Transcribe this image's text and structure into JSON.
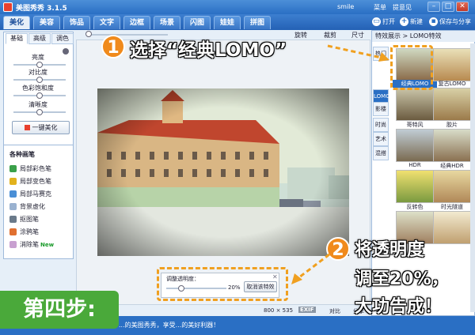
{
  "titlebar": {
    "app_name": "美图秀秀 3.1.5",
    "user": "smile",
    "links": [
      "菜单",
      "提意见"
    ],
    "buttons": [
      "–",
      "□",
      "✕"
    ]
  },
  "menu": {
    "tabs": [
      "美化",
      "美容",
      "饰品",
      "文字",
      "边框",
      "场景",
      "闪图",
      "娃娃",
      "拼图"
    ],
    "actions": [
      "打开",
      "新建",
      "保存与分享"
    ]
  },
  "left_panel": {
    "subtabs": [
      "基础",
      "高级",
      "调色"
    ],
    "sliders": [
      {
        "label": "亮度",
        "value": 0.5
      },
      {
        "label": "对比度",
        "value": 0.5
      },
      {
        "label": "色彩饱和度",
        "value": 0.5
      },
      {
        "label": "清晰度",
        "value": 0.5
      }
    ],
    "one_click": "一键美化",
    "brush_title": "各种画笔",
    "brushes": [
      {
        "label": "局部彩色笔",
        "color": "#3aa04a",
        "new": false
      },
      {
        "label": "局部变色笔",
        "color": "#e2b21c",
        "new": false
      },
      {
        "label": "局部马赛克",
        "color": "#4a8fd6",
        "new": false
      },
      {
        "label": "背景虚化",
        "color": "#9ab2d0",
        "new": false
      },
      {
        "label": "抠图笔",
        "color": "#6a7a8a",
        "new": false
      },
      {
        "label": "涂鸦笔",
        "color": "#e07030",
        "new": false
      },
      {
        "label": "消除笔",
        "color": "#c8a0d0",
        "new": true
      }
    ],
    "new_label": "New"
  },
  "toolbar": {
    "items": [
      "旋转",
      "裁剪",
      "尺寸"
    ]
  },
  "right_panel": {
    "header": "特效展示 > LOMO特效",
    "categories": [
      "热门",
      "LOMO",
      "影楼",
      "时尚",
      "艺术",
      "混搭"
    ],
    "thumbs": [
      {
        "label": "经典LOMO",
        "selected": true
      },
      {
        "label": "复古LOMO",
        "selected": false
      },
      {
        "label": "哥特风",
        "selected": false
      },
      {
        "label": "胶片",
        "selected": false
      },
      {
        "label": "HDR",
        "selected": false
      },
      {
        "label": "经典HDR",
        "selected": false
      },
      {
        "label": "反转色",
        "selected": false
      },
      {
        "label": "时光隧道",
        "selected": false
      },
      {
        "label": "",
        "selected": false
      },
      {
        "label": "",
        "selected": false
      }
    ]
  },
  "dialog": {
    "title": "调整透明度：",
    "value": "20%",
    "cancel": "取消该特效",
    "level": 0.2
  },
  "statusbar": {
    "size": "800 × 535",
    "exif": "EXIF",
    "compare": "对比",
    "share": "分享"
  },
  "bottombar": {
    "text": "...的美图秀秀，享受...的美好利器！"
  },
  "annotations": {
    "step1_num": "1",
    "step1_text": "选择“经典LOMO”",
    "step2_num": "2",
    "step2_lines": [
      "将透明度",
      "调至20%，",
      "大功告成！"
    ],
    "step_banner": "第四步:"
  },
  "colors": {
    "accent": "#2a6fc4",
    "annotation": "#f08a1c",
    "banner": "#4aa93a"
  }
}
